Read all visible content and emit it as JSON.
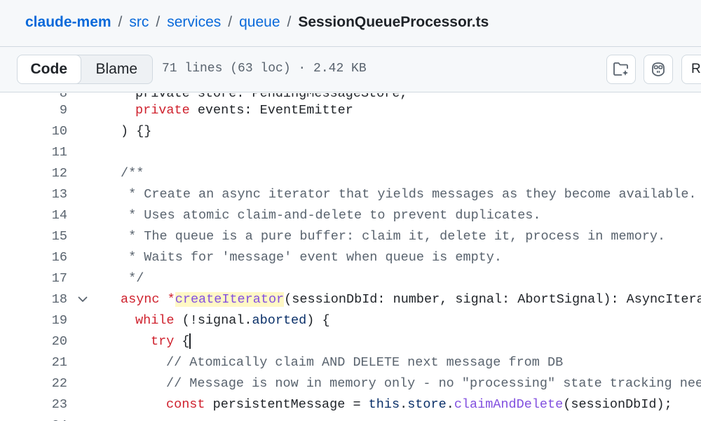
{
  "breadcrumb": {
    "repo": "claude-mem",
    "parts": [
      "src",
      "services",
      "queue"
    ],
    "file": "SessionQueueProcessor.ts",
    "separator": "/"
  },
  "toolbar": {
    "code_label": "Code",
    "blame_label": "Blame",
    "file_info": "71 lines (63 loc) · 2.42 KB",
    "raw_label": "Raw"
  },
  "icons": {
    "folder": "folder-sparkle-icon",
    "copilot": "copilot-icon",
    "fold": "chevron-down-icon"
  },
  "colors": {
    "link": "#0969da",
    "keyword": "#cf222e",
    "function": "#8250df",
    "comment": "#59636e",
    "highlight": "#fff8c5"
  },
  "lines": {
    "partial": {
      "num": "8",
      "text": "private store: PendingMessageStore,"
    },
    "l9": {
      "num": "9",
      "kw": "private",
      "rest": " events: EventEmitter"
    },
    "l10": {
      "num": "10",
      "text": ") {}"
    },
    "l11": {
      "num": "11"
    },
    "l12": {
      "num": "12",
      "text": "/**"
    },
    "l13": {
      "num": "13",
      "text": " * Create an async iterator that yields messages as they become available."
    },
    "l14": {
      "num": "14",
      "text": " * Uses atomic claim-and-delete to prevent duplicates."
    },
    "l15": {
      "num": "15",
      "text": " * The queue is a pure buffer: claim it, delete it, process in memory."
    },
    "l16": {
      "num": "16",
      "text": " * Waits for 'message' event when queue is empty."
    },
    "l17": {
      "num": "17",
      "text": " */"
    },
    "l18": {
      "num": "18",
      "kw1": "async",
      "star": " *",
      "fn": "createIterator",
      "rest": "(sessionDbId: number, signal: AbortSignal): AsyncIterable"
    },
    "l19": {
      "num": "19",
      "kw": "while",
      "p1": " (!signal.",
      "prop": "aborted",
      "p2": ") {"
    },
    "l20": {
      "num": "20",
      "kw": "try",
      "rest": " {"
    },
    "l21": {
      "num": "21",
      "text": "// Atomically claim AND DELETE next message from DB"
    },
    "l22": {
      "num": "22",
      "text": "// Message is now in memory only - no \"processing\" state tracking needed"
    },
    "l23": {
      "num": "23",
      "kw": "const",
      "p1": " persistentMessage = ",
      "this": "this",
      "p2": ".",
      "store": "store",
      "p3": ".",
      "fn": "claimAndDelete",
      "p4": "(sessionDbId);"
    },
    "l24": {
      "num": "24"
    }
  }
}
